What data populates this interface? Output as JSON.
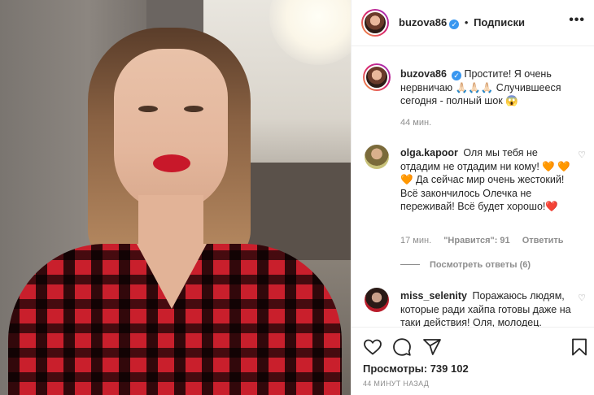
{
  "header": {
    "username": "buzova86",
    "separator": "•",
    "follow_label": "Подписки",
    "more_label": "•••"
  },
  "caption": {
    "username": "buzova86",
    "text": "Простите! Я очень нервничаю 🙏🏻🙏🏻🙏🏻 Случившееся сегодня - полный шок 😱",
    "time": "44 мин."
  },
  "comments": [
    {
      "username": "olga.kapoor",
      "text": "Оля мы тебя не отдадим не отдадим ни кому! 🧡 🧡 🧡 Да сейчас мир очень жестокий! Всё закончилось Олечка не переживай! Всё будет хорошо!❤️",
      "time": "17 мин.",
      "likes": "\"Нравится\": 91",
      "reply_label": "Ответить",
      "view_replies": "Посмотреть ответы (6)"
    },
    {
      "username": "miss_selenity",
      "text": "Поражаюсь людям, которые ради хайпа готовы даже на таки действия! Оля, молодец."
    }
  ],
  "footer": {
    "views": "Просмотры: 739 102",
    "time": "44 минут назад"
  },
  "icons": {
    "verified": "verified-badge-icon",
    "like": "heart-icon",
    "comment": "comment-icon",
    "share": "share-icon",
    "save": "bookmark-icon"
  },
  "colors": {
    "accent": "#3897f0",
    "text": "#262626",
    "muted": "#8e8e8e",
    "border": "#efefef"
  }
}
